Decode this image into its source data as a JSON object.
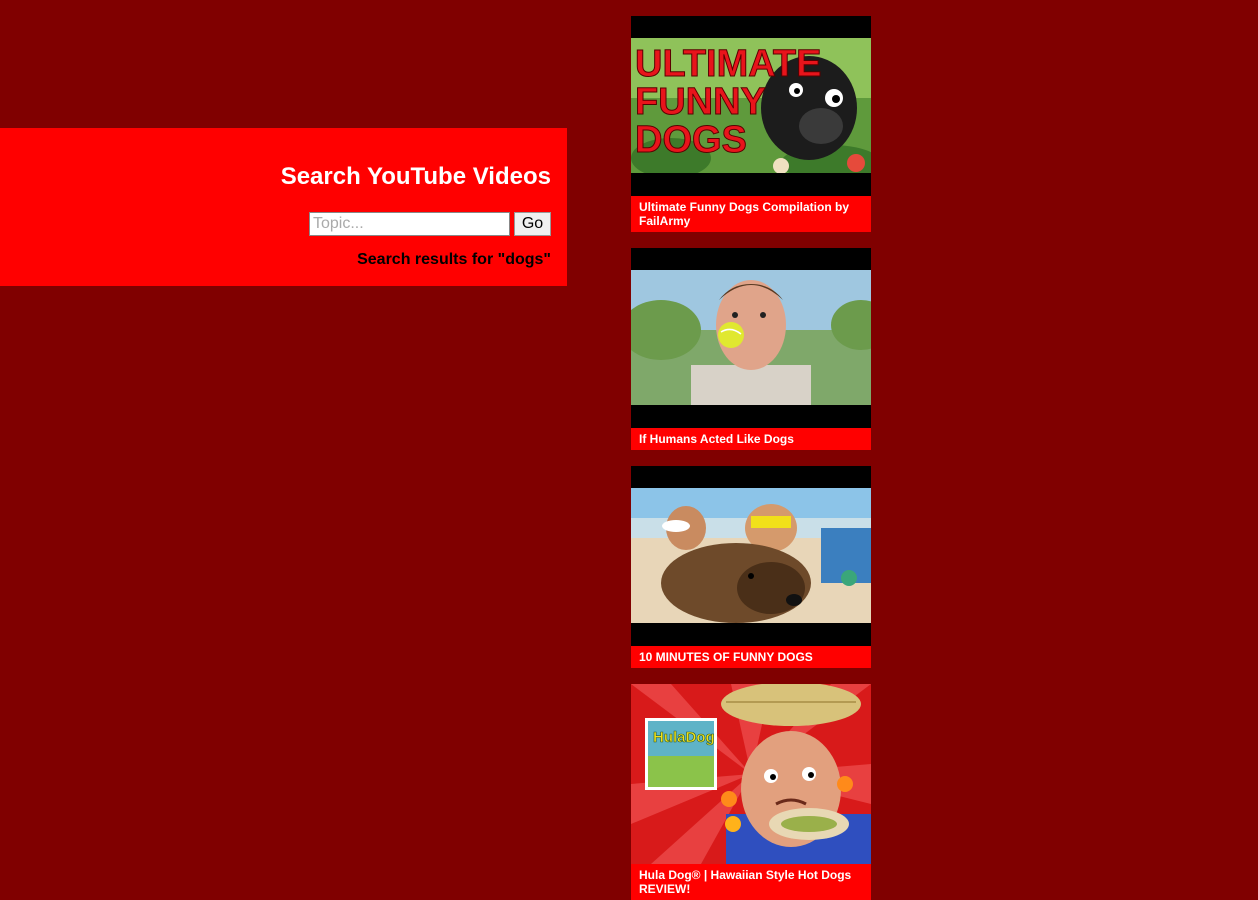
{
  "search": {
    "title": "Search YouTube Videos",
    "input_value": "",
    "placeholder": "Topic...",
    "go_label": "Go",
    "results_label": "Search results for \"dogs\""
  },
  "videos": [
    {
      "title": "Ultimate Funny Dogs Compilation by FailArmy",
      "thumb_text": [
        "ULTIMATE",
        "FUNNY",
        "DOGS"
      ]
    },
    {
      "title": "If Humans Acted Like Dogs"
    },
    {
      "title": "10 MINUTES OF FUNNY DOGS"
    },
    {
      "title": "Hula Dog® | Hawaiian Style Hot Dogs REVIEW!",
      "thumb_text": [
        "HulaDog"
      ]
    }
  ],
  "colors": {
    "page_background": "#800000",
    "panel_background": "#ff0000",
    "caption_background": "#ff0000"
  }
}
